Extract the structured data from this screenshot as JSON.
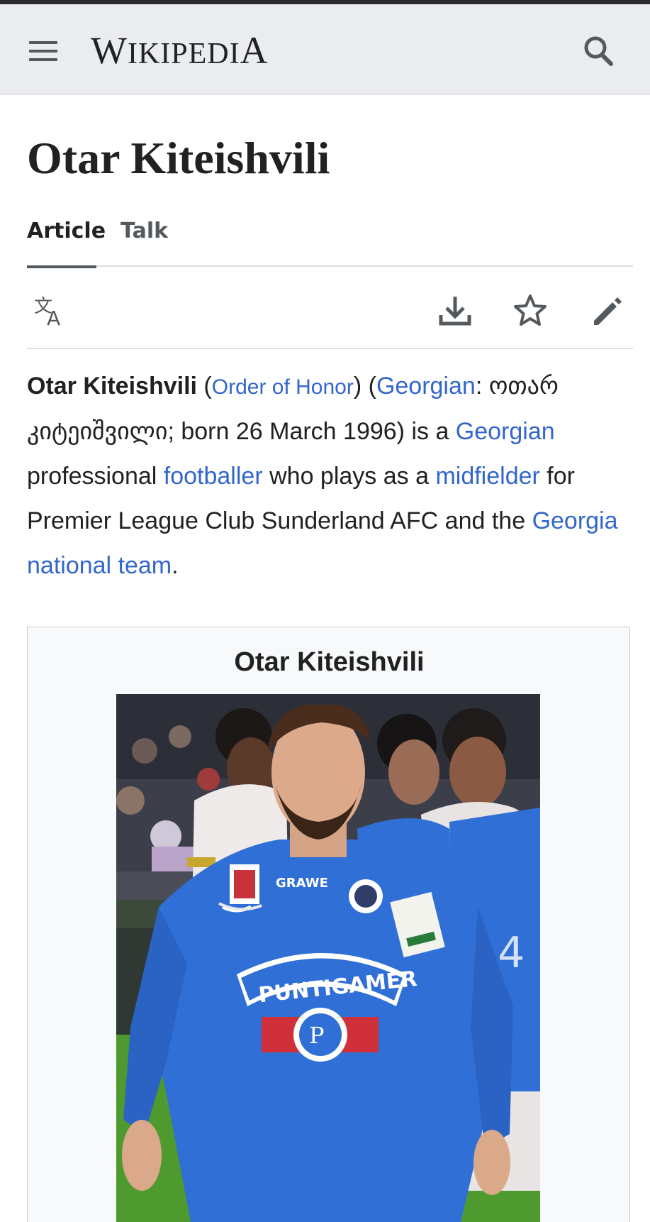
{
  "header": {
    "wordmark_big_1": "W",
    "wordmark_small_1": "IKIPEDI",
    "wordmark_big_2": "A",
    "menu_icon": "hamburger-menu-icon",
    "search_icon": "search-icon"
  },
  "page": {
    "title": "Otar Kiteishvili"
  },
  "tabs": [
    {
      "label": "Article",
      "selected": true
    },
    {
      "label": "Talk",
      "selected": false
    }
  ],
  "actions": {
    "language_icon": "language-icon",
    "download_icon": "download-icon",
    "watch_icon": "star-icon",
    "edit_icon": "pencil-icon"
  },
  "lead": {
    "name": "Otar Kiteishvili",
    "p1": " (",
    "link_order": "Order of Honor",
    "p2": ") (",
    "link_georgian_lang": "Georgian",
    "p3": ": ოთარ კიტეიშვილი; born 26 March 1996) is a ",
    "link_georgian": "Georgian",
    "p4": " professional ",
    "link_footballer": "footballer",
    "p5": " who plays as a ",
    "link_midfielder": "midfielder",
    "p6": " for Premier League Club Sunderland AFC and the ",
    "link_national_team": "Georgia national team",
    "p7": "."
  },
  "infobox": {
    "title": "Otar Kiteishvili",
    "jersey_sponsor": "PUNTIGAMER",
    "sleeve_sponsor": "GRAWE"
  },
  "colors": {
    "link": "#3366cc",
    "header_bg": "#eaecf0",
    "text": "#202122",
    "icon": "#54595d",
    "jersey": "#2f6fd6"
  }
}
